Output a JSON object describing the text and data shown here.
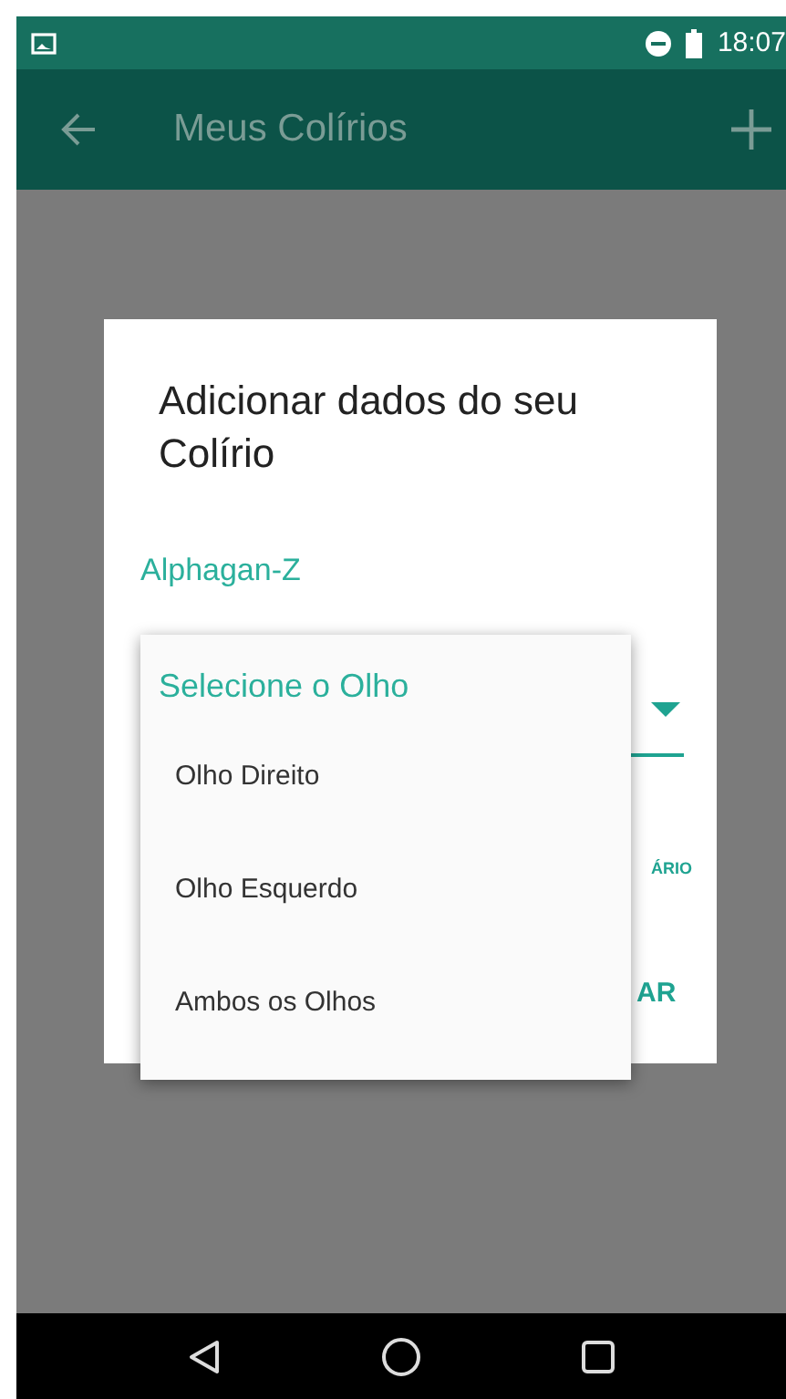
{
  "status_bar": {
    "time": "18:07"
  },
  "toolbar": {
    "title": "Meus Colírios"
  },
  "dialog": {
    "title": "Adicionar dados do seu Colírio",
    "name_value": "Alphagan-Z",
    "button_fragments": [
      "ÁRIO",
      "AR"
    ]
  },
  "dropdown": {
    "header": "Selecione o Olho",
    "options": [
      "Olho Direito",
      "Olho Esquerdo",
      "Ambos os Olhos"
    ]
  }
}
